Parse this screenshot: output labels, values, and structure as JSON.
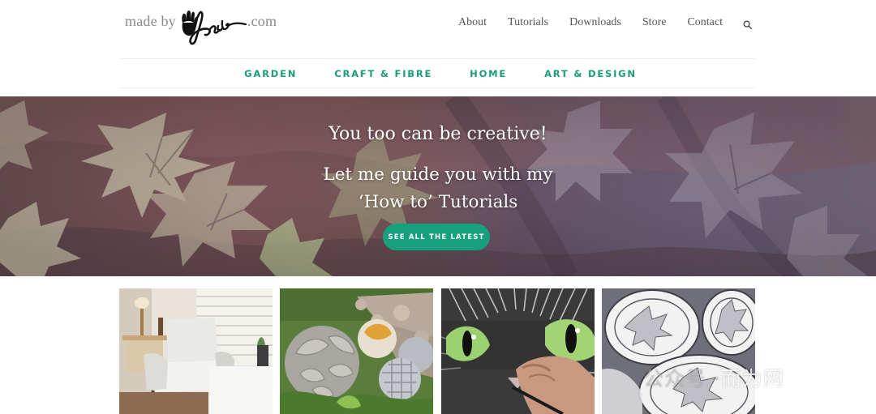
{
  "logo": {
    "prefix": "made by",
    "signature": "Babs",
    "suffix": ".com"
  },
  "top_nav": [
    {
      "label": "About"
    },
    {
      "label": "Tutorials"
    },
    {
      "label": "Downloads"
    },
    {
      "label": "Store"
    },
    {
      "label": "Contact"
    }
  ],
  "search": {
    "icon": "search-icon"
  },
  "category_nav": [
    {
      "label": "GARDEN"
    },
    {
      "label": "CRAFT & FIBRE"
    },
    {
      "label": "HOME"
    },
    {
      "label": "ART & DESIGN"
    }
  ],
  "hero": {
    "title": "You too can be creative!",
    "subtitle_line1": "Let me guide you with my",
    "subtitle_line2": "‘How to’ Tutorials",
    "cta_label": "SEE ALL THE LATEST"
  },
  "thumbnails": [
    {
      "subject": "armchair-room-photo"
    },
    {
      "subject": "garden-leaf-spheres-photo"
    },
    {
      "subject": "cat-painting-photo"
    },
    {
      "subject": "leaf-bowls-photo"
    }
  ],
  "watermark": {
    "text_dim": "公众号 · ",
    "text": "而为网"
  },
  "colors": {
    "accent": "#1d9a7c",
    "button": "#17a07e",
    "nav_text": "#555555",
    "logo_text": "#8a8a8a"
  }
}
